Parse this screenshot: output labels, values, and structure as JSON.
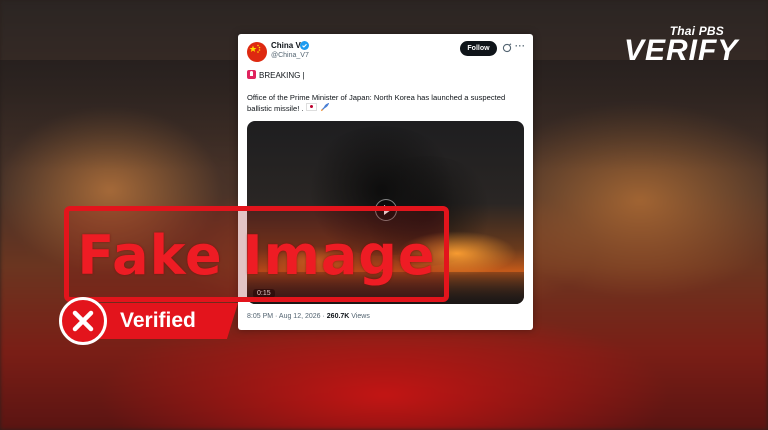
{
  "logo": {
    "top": "Thai PBS",
    "main": "VERIFY"
  },
  "tweet": {
    "name": "China V",
    "handle": "@China_V7",
    "follow_label": "Follow",
    "more": "···",
    "breaking": "BREAKING |",
    "text": "Office of the Prime Minister of Japan: North Korea has launched a suspected ballistic missile! .",
    "video_duration": "0:15",
    "timestamp": "8:05 PM · Aug 12, 2026 · ",
    "views_count": "260.7K",
    "views_label": " Views"
  },
  "stamp": {
    "text": "Fake Image"
  },
  "verdict": {
    "label": "Verified"
  },
  "colors": {
    "accent_red": "#e3141c",
    "twitter_blue": "#1d9bf0"
  }
}
